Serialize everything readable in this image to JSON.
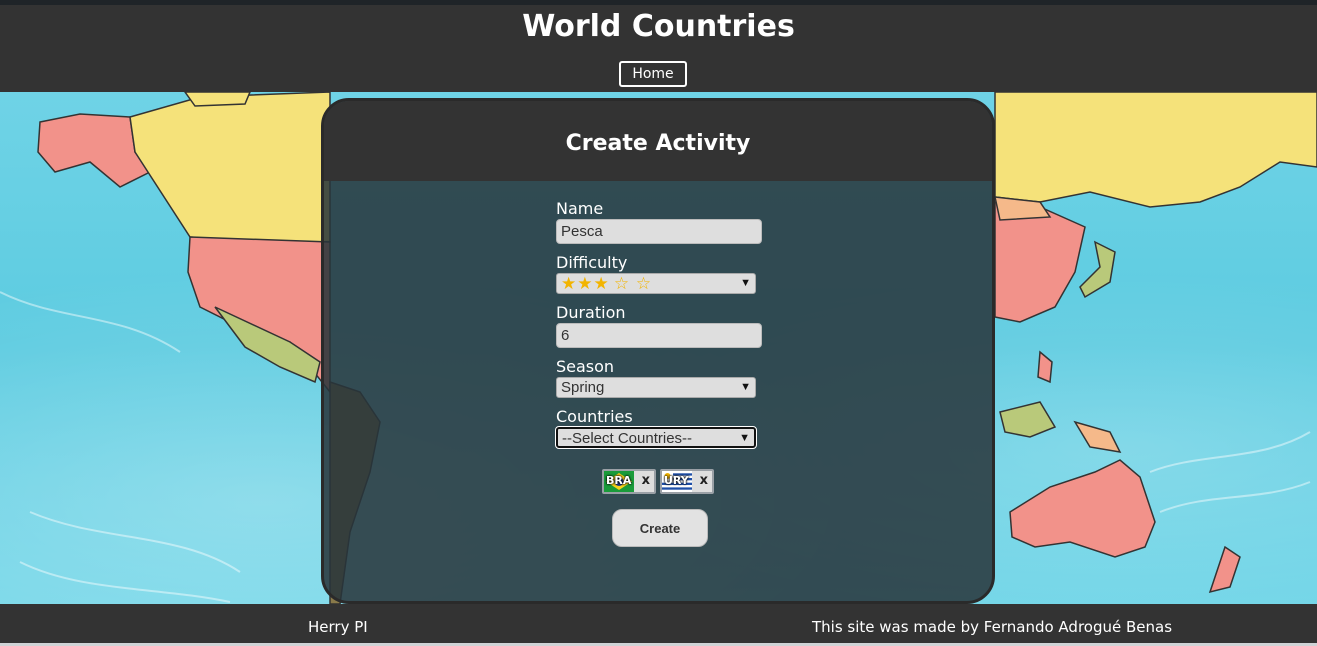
{
  "header": {
    "title": "World Countries",
    "home_label": "Home"
  },
  "card": {
    "title": "Create Activity",
    "create_label": "Create"
  },
  "form": {
    "name": {
      "label": "Name",
      "value": "Pesca"
    },
    "difficulty": {
      "label": "Difficulty",
      "value": 3,
      "max": 5,
      "filled_glyph": "★★★",
      "empty_glyph": "☆ ☆"
    },
    "duration": {
      "label": "Duration",
      "value": "6"
    },
    "season": {
      "label": "Season",
      "value": "Spring"
    },
    "countries": {
      "label": "Countries",
      "value": "--Select Countries--"
    }
  },
  "selected_countries": [
    {
      "code": "BRA",
      "remove": "x"
    },
    {
      "code": "URY",
      "remove": "x"
    }
  ],
  "footer": {
    "left": "Herry PI",
    "right": "This site was made by Fernando Adrogué Benas"
  },
  "colors": {
    "bar": "#333333",
    "ocean": "#5fcde0",
    "accent_star": "#f2b400"
  }
}
